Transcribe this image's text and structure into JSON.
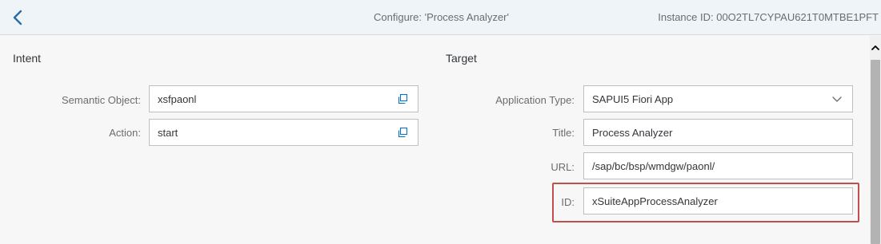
{
  "header": {
    "title": "Configure: 'Process Analyzer'",
    "instance_id": "Instance ID: 00O2TL7CYPAU621T0MTBE1PFT",
    "back_icon": "chevron-left-icon"
  },
  "intent": {
    "title": "Intent",
    "fields": [
      {
        "label": "Semantic Object:",
        "value": "xsfpaonl",
        "icon": "value-help-icon"
      },
      {
        "label": "Action:",
        "value": "start",
        "icon": "value-help-icon"
      }
    ]
  },
  "target": {
    "title": "Target",
    "application_type": {
      "label": "Application Type:",
      "value": "SAPUI5 Fiori App",
      "icon": "chevron-down-icon"
    },
    "title_field": {
      "label": "Title:",
      "value": "Process Analyzer"
    },
    "url_field": {
      "label": "URL:",
      "value": "/sap/bc/bsp/wmdgw/paonl/"
    },
    "id_field": {
      "label": "ID:",
      "value": "xSuiteAppProcessAnalyzer"
    }
  },
  "colors": {
    "header_bg": "#eff4f9",
    "accent": "#0a6ed1",
    "highlight": "#c0504d"
  }
}
